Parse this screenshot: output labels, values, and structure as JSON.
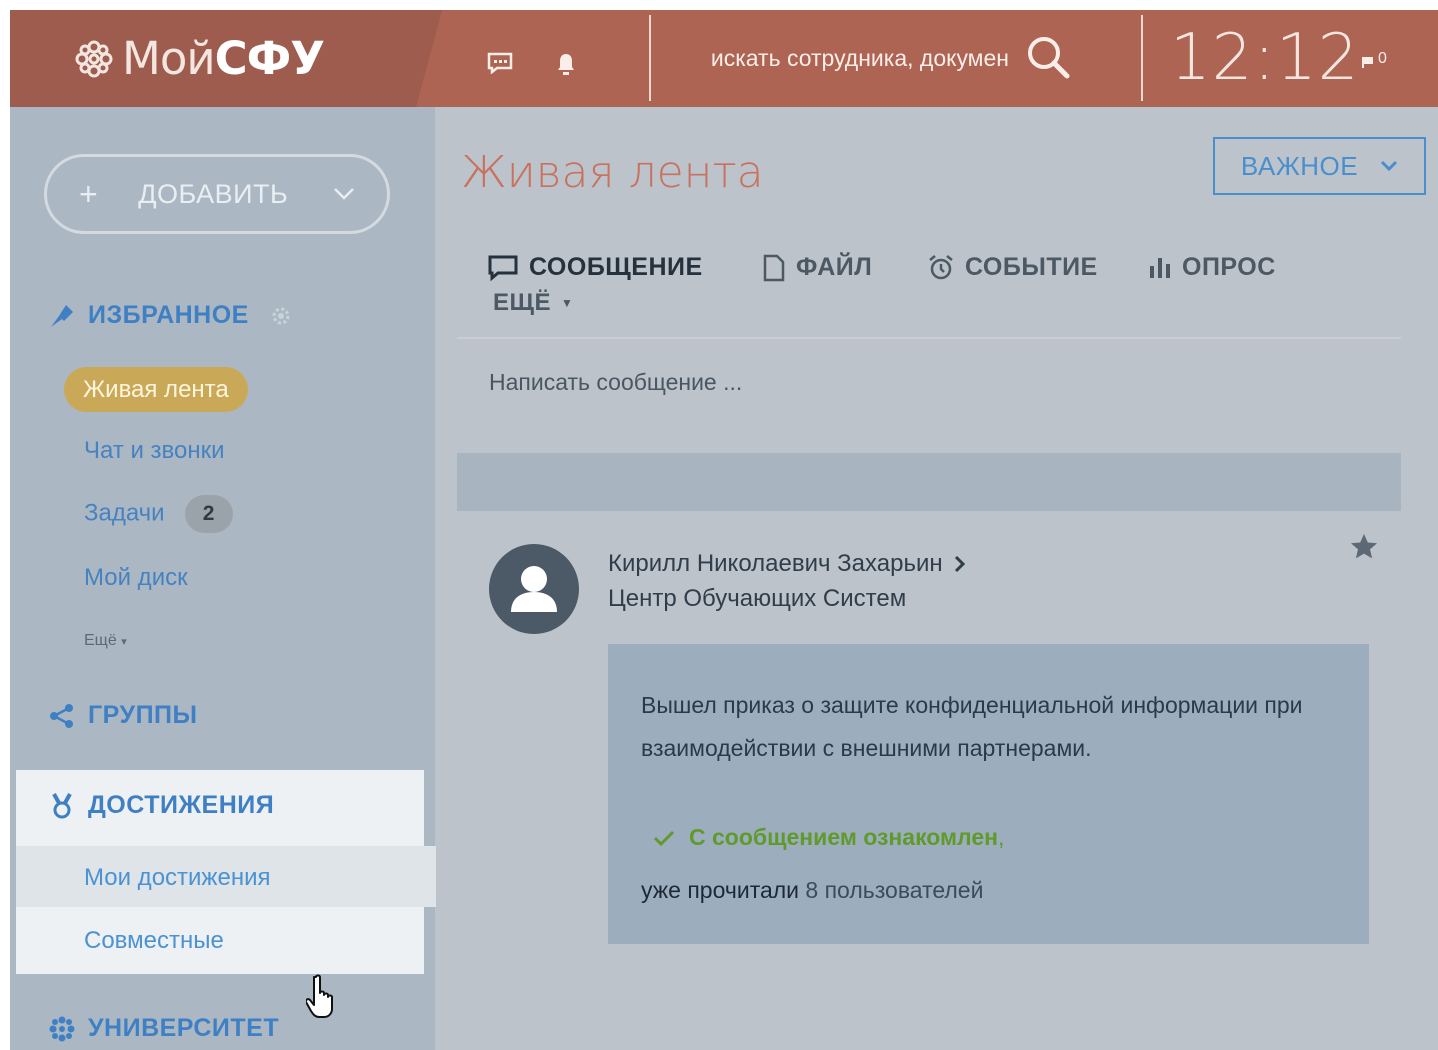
{
  "header": {
    "logo_prefix": "Мой",
    "logo_bold": "СФУ",
    "search_placeholder": "искать сотрудника, докумен",
    "clock": "12:12",
    "flag_count": "0"
  },
  "sidebar": {
    "add_button": "ДОБАВИТЬ",
    "favorites": {
      "title": "ИЗБРАННОЕ",
      "items": [
        {
          "label": "Живая лента",
          "active": true
        },
        {
          "label": "Чат и звонки"
        },
        {
          "label": "Задачи",
          "badge": "2"
        },
        {
          "label": "Мой диск"
        }
      ],
      "more": "Ещё"
    },
    "groups_title": "ГРУППЫ",
    "achievements": {
      "title": "ДОСТИЖЕНИЯ",
      "items": [
        {
          "label": "Мои достижения"
        },
        {
          "label": "Совместные"
        }
      ]
    },
    "university_title": "УНИВЕРСИТЕТ"
  },
  "main": {
    "title": "Живая лента",
    "important_button": "ВАЖНОЕ",
    "tabs": [
      {
        "label": "СООБЩЕНИЕ",
        "icon": "message-icon"
      },
      {
        "label": "ФАЙЛ",
        "icon": "file-icon"
      },
      {
        "label": "СОБЫТИЕ",
        "icon": "alarm-icon"
      },
      {
        "label": "ОПРОС",
        "icon": "poll-icon"
      },
      {
        "label": "ЕЩЁ",
        "icon": "caret-down-icon"
      }
    ],
    "compose_placeholder": "Написать сообщение ...",
    "post": {
      "author": "Кирилл Николаевич Захарьин",
      "org": "Центр Обучающих Систем",
      "text": "Вышел приказ о защите конфиденциальной информации при взаимодействии с внешними партнерами.",
      "ack": "С сообщением ознакомлен",
      "read_prefix": "уже прочитали",
      "read_count": "8 пользователей"
    }
  },
  "colors": {
    "header": "#ad6452",
    "sidebar": "#abb8c4",
    "accent_blue": "#3f7fc3",
    "title": "#c9705f",
    "active_pill": "#c9a957",
    "ack_green": "#5f9a2a"
  }
}
